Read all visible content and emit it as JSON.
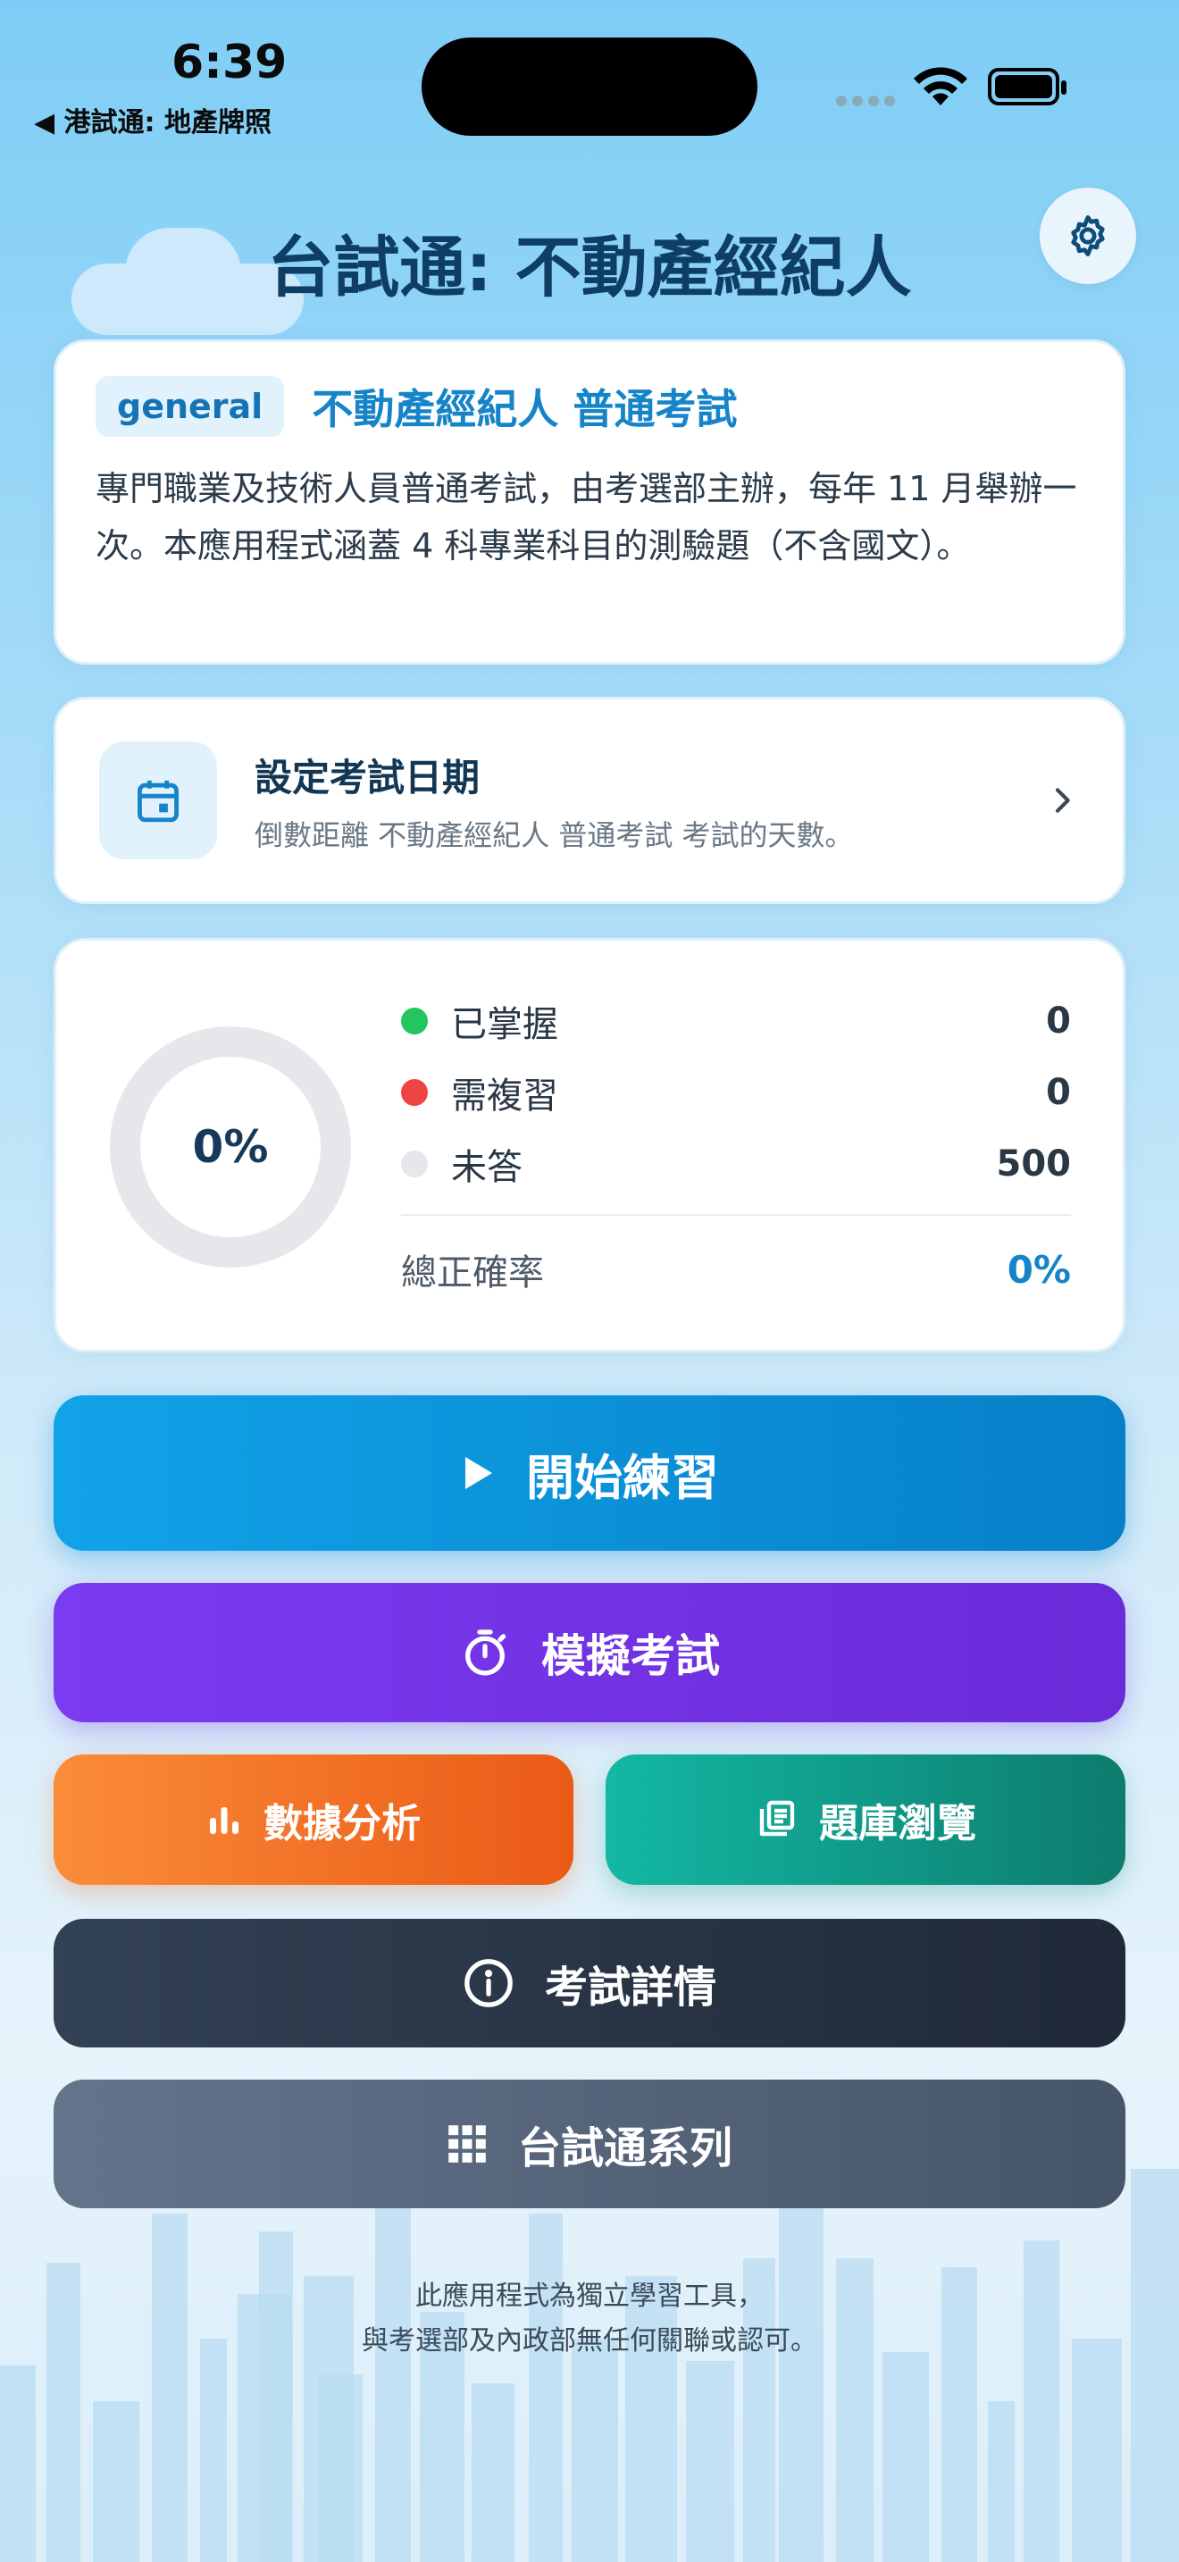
{
  "status_bar": {
    "time": "6:39",
    "back_label": "◀ 港試通: 地產牌照"
  },
  "header": {
    "title": "台試通: 不動產經紀人"
  },
  "exam_card": {
    "tag": "general",
    "name": "不動產經紀人 普通考試",
    "description": "專門職業及技術人員普通考試，由考選部主辦，每年 11 月舉辦一次。本應用程式涵蓋 4 科專業科目的測驗題（不含國文）。"
  },
  "date_card": {
    "title": "設定考試日期",
    "subtitle": "倒數距離 不動產經紀人 普通考試 考試的天數。"
  },
  "stats": {
    "progress_label": "0%",
    "progress_fraction": 0,
    "rows": [
      {
        "label": "已掌握",
        "value": "0",
        "color": "#22c55e"
      },
      {
        "label": "需複習",
        "value": "0",
        "color": "#ef4444"
      },
      {
        "label": "未答",
        "value": "500",
        "color": "#e5e7eb"
      }
    ],
    "accuracy_label": "總正確率",
    "accuracy_value": "0%"
  },
  "buttons": {
    "practice": "開始練習",
    "mock_exam": "模擬考試",
    "analysis": "數據分析",
    "question_bank": "題庫瀏覽",
    "exam_details": "考試詳情",
    "series": "台試通系列"
  },
  "footer": {
    "line1": "此應用程式為獨立學習工具，",
    "line2": "與考選部及內政部無任何關聯或認可。"
  },
  "colors": {
    "accent": "#1684c9",
    "practice": "#0680c9",
    "mock": "#6a2bd9",
    "analysis": "#ea5a16",
    "bank": "#0d7c6d",
    "details": "#1f2937",
    "series": "#475569"
  }
}
